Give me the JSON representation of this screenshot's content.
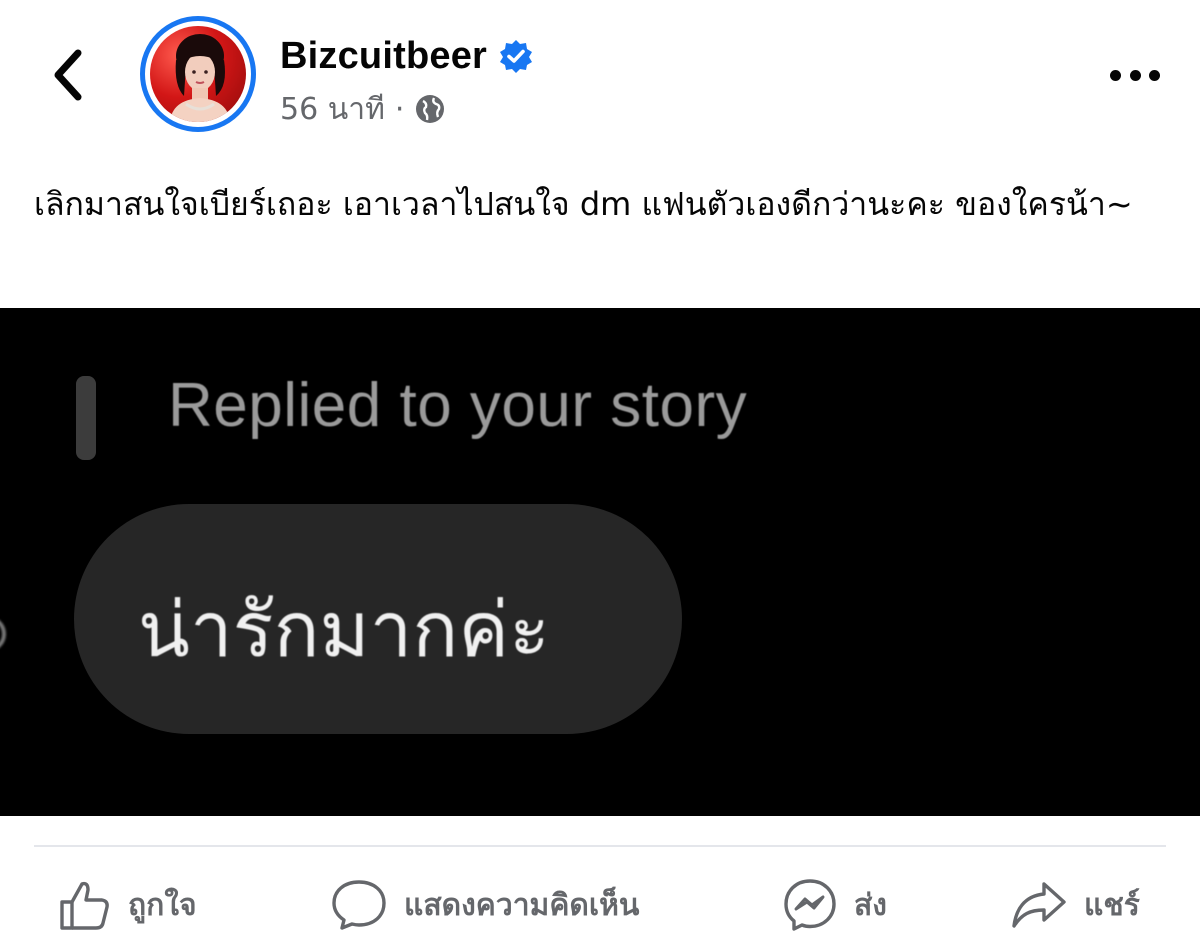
{
  "header": {
    "back_icon": "chevron-left-icon",
    "author_name": "Bizcuitbeer",
    "verified_icon": "verified-badge-icon",
    "timestamp": "56 นาที",
    "separator": "·",
    "privacy_icon": "globe-icon",
    "more_icon": "more-horizontal-icon"
  },
  "post": {
    "text": "เลิกมาสนใจเบียร์เถอะ เอาเวลาไปสนใจ dm แฟนตัวเองดีกว่านะคะ ของใครน้า~"
  },
  "image": {
    "reply_label": "Replied to your story",
    "message": "น่ารักมากค่ะ"
  },
  "actions": [
    {
      "label": "ถูกใจ",
      "icon": "thumbs-up-icon"
    },
    {
      "label": "แสดงความคิดเห็น",
      "icon": "comment-icon"
    },
    {
      "label": "ส่ง",
      "icon": "messenger-icon"
    },
    {
      "label": "แชร์",
      "icon": "share-icon"
    }
  ],
  "colors": {
    "accent": "#1877f2",
    "secondary_text": "#65676b",
    "image_background": "#000000",
    "bubble": "#262626"
  }
}
